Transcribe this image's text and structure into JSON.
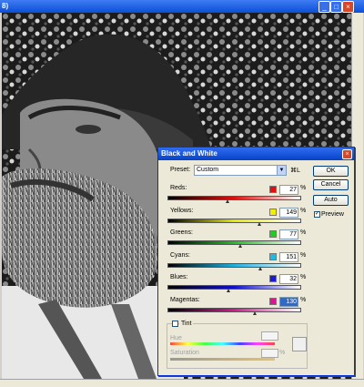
{
  "document": {
    "title_fragment": "8)"
  },
  "dialog": {
    "title": "Black and White",
    "preset_label": "Preset:",
    "preset_value": "Custom",
    "preset_shortcut": "⌘L",
    "buttons": {
      "ok": "OK",
      "cancel": "Cancel",
      "auto": "Auto"
    },
    "preview_label": "Preview",
    "percent": "%",
    "sliders": [
      {
        "label": "Reds:",
        "value": "27",
        "level": 27,
        "color": "#e01010"
      },
      {
        "label": "Yellows:",
        "value": "149",
        "level": 149,
        "color": "#f0f000"
      },
      {
        "label": "Greens:",
        "value": "77",
        "level": 77,
        "color": "#22cc22"
      },
      {
        "label": "Cyans:",
        "value": "151",
        "level": 151,
        "color": "#22b8e0"
      },
      {
        "label": "Blues:",
        "value": "32",
        "level": 32,
        "color": "#1a1ad0"
      },
      {
        "label": "Magentas:",
        "value": "130",
        "level": 130,
        "color": "#d81890"
      }
    ],
    "tint": {
      "label": "Tint",
      "hue_label": "Hue",
      "saturation_label": "Saturation",
      "percent": "%"
    }
  }
}
